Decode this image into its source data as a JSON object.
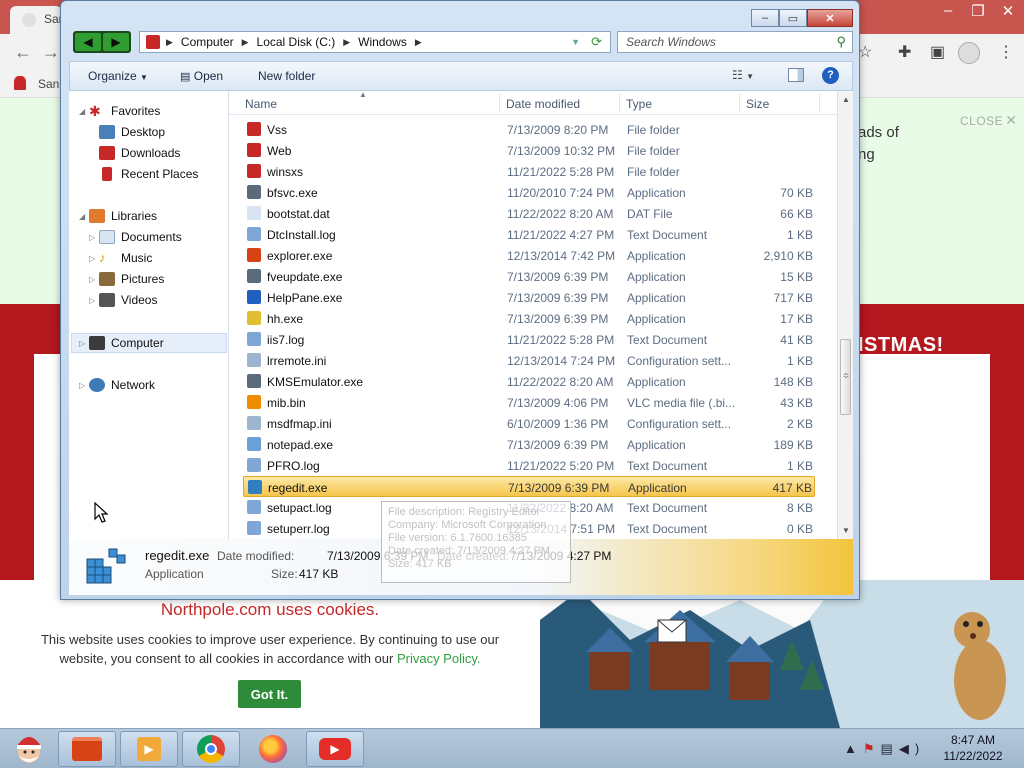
{
  "browser": {
    "tab_label": "San",
    "bookmark_label": "San",
    "promo_text": "ads of\nng",
    "close_label": "CLOSE",
    "banner_text": "ISTMAS!",
    "cookie": {
      "title": "Northpole.com uses cookies.",
      "text": "This website uses cookies to improve user experience. By continuing to use our website, you consent to all cookies in accordance with our ",
      "link": "Privacy Policy.",
      "button": "Got It."
    }
  },
  "explorer": {
    "breadcrumb": [
      "Computer",
      "Local Disk (C:)",
      "Windows"
    ],
    "search_placeholder": "Search Windows",
    "toolbar": {
      "organize": "Organize",
      "open": "Open",
      "new_folder": "New folder"
    },
    "nav": {
      "favorites": "Favorites",
      "desktop": "Desktop",
      "downloads": "Downloads",
      "recent": "Recent Places",
      "libraries": "Libraries",
      "documents": "Documents",
      "music": "Music",
      "pictures": "Pictures",
      "videos": "Videos",
      "computer": "Computer",
      "network": "Network"
    },
    "columns": {
      "name": "Name",
      "date": "Date modified",
      "type": "Type",
      "size": "Size"
    },
    "files": [
      {
        "name": "Vss",
        "date": "7/13/2009 8:20 PM",
        "type": "File folder",
        "size": "",
        "icon": "folder-icon",
        "color": "#c62828"
      },
      {
        "name": "Web",
        "date": "7/13/2009 10:32 PM",
        "type": "File folder",
        "size": "",
        "icon": "folder-icon",
        "color": "#c62828"
      },
      {
        "name": "winsxs",
        "date": "11/21/2022 5:28 PM",
        "type": "File folder",
        "size": "",
        "icon": "folder-icon",
        "color": "#c62828"
      },
      {
        "name": "bfsvc.exe",
        "date": "11/20/2010 7:24 PM",
        "type": "Application",
        "size": "70 KB",
        "icon": "exe-icon",
        "color": "#5b6b7c"
      },
      {
        "name": "bootstat.dat",
        "date": "11/22/2022 8:20 AM",
        "type": "DAT File",
        "size": "66 KB",
        "icon": "dat-file-icon",
        "color": "#d9e4f2"
      },
      {
        "name": "DtcInstall.log",
        "date": "11/21/2022 4:27 PM",
        "type": "Text Document",
        "size": "1 KB",
        "icon": "text-document-icon",
        "color": "#7fa7d6"
      },
      {
        "name": "explorer.exe",
        "date": "12/13/2014 7:42 PM",
        "type": "Application",
        "size": "2,910 KB",
        "icon": "explorer-icon",
        "color": "#d84315"
      },
      {
        "name": "fveupdate.exe",
        "date": "7/13/2009 6:39 PM",
        "type": "Application",
        "size": "15 KB",
        "icon": "exe-icon",
        "color": "#5b6b7c"
      },
      {
        "name": "HelpPane.exe",
        "date": "7/13/2009 6:39 PM",
        "type": "Application",
        "size": "717 KB",
        "icon": "help-icon",
        "color": "#1f5fbf"
      },
      {
        "name": "hh.exe",
        "date": "7/13/2009 6:39 PM",
        "type": "Application",
        "size": "17 KB",
        "icon": "help-book-icon",
        "color": "#e0c030"
      },
      {
        "name": "iis7.log",
        "date": "11/21/2022 5:28 PM",
        "type": "Text Document",
        "size": "41 KB",
        "icon": "text-document-icon",
        "color": "#7fa7d6"
      },
      {
        "name": "lrremote.ini",
        "date": "12/13/2014 7:24 PM",
        "type": "Configuration sett...",
        "size": "1 KB",
        "icon": "config-icon",
        "color": "#9eb5cf"
      },
      {
        "name": "KMSEmulator.exe",
        "date": "11/22/2022 8:20 AM",
        "type": "Application",
        "size": "148 KB",
        "icon": "exe-icon",
        "color": "#5b6b7c"
      },
      {
        "name": "mib.bin",
        "date": "7/13/2009 4:06 PM",
        "type": "VLC media file (.bi...",
        "size": "43 KB",
        "icon": "vlc-icon",
        "color": "#f08c00"
      },
      {
        "name": "msdfmap.ini",
        "date": "6/10/2009 1:36 PM",
        "type": "Configuration sett...",
        "size": "2 KB",
        "icon": "config-icon",
        "color": "#9eb5cf"
      },
      {
        "name": "notepad.exe",
        "date": "7/13/2009 6:39 PM",
        "type": "Application",
        "size": "189 KB",
        "icon": "notepad-icon",
        "color": "#6aa0d8"
      },
      {
        "name": "PFRO.log",
        "date": "11/21/2022 5:20 PM",
        "type": "Text Document",
        "size": "1 KB",
        "icon": "text-document-icon",
        "color": "#7fa7d6"
      },
      {
        "name": "regedit.exe",
        "date": "7/13/2009 6:39 PM",
        "type": "Application",
        "size": "417 KB",
        "icon": "regedit-icon",
        "color": "#2f7fbf",
        "selected": true
      },
      {
        "name": "setupact.log",
        "date": "11/22/2022 8:20 AM",
        "type": "Text Document",
        "size": "8 KB",
        "icon": "text-document-icon",
        "color": "#7fa7d6"
      },
      {
        "name": "setuperr.log",
        "date": "12/13/2014 7:51 PM",
        "type": "Text Document",
        "size": "0 KB",
        "icon": "text-document-icon",
        "color": "#7fa7d6"
      }
    ],
    "tooltip": [
      "File description: Registry Editor",
      "Company: Microsoft Corporation",
      "File version: 6.1.7600.16385",
      "Date created: 7/13/2009 4:27 PM",
      "Size: 417 KB"
    ],
    "details": {
      "name": "regedit.exe",
      "type": "Application",
      "modified_label": "Date modified:",
      "modified": "7/13/2009 6:39 PM",
      "size_label": "Size:",
      "size": "417 KB",
      "created_label": "Date created:",
      "created": "7/13/2009 4:27 PM"
    }
  },
  "taskbar": {
    "time": "8:47 AM",
    "date": "11/22/2022"
  }
}
